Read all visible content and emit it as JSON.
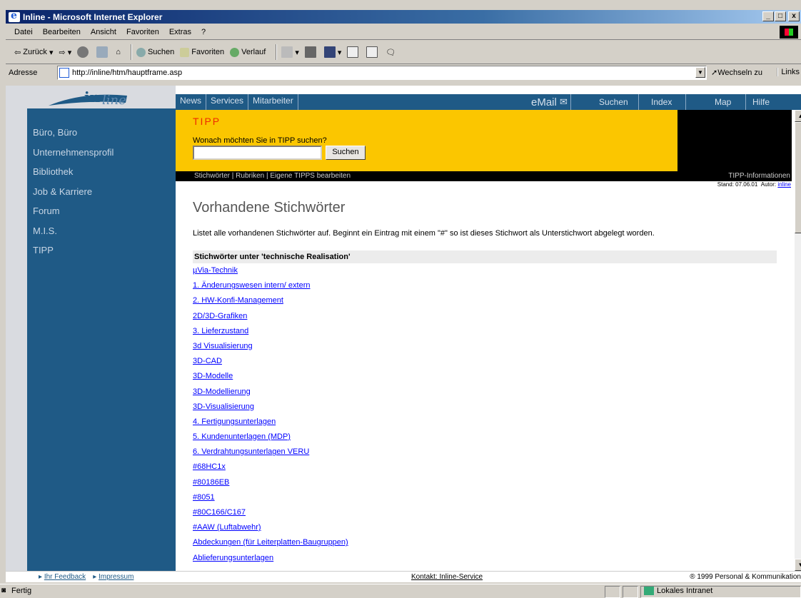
{
  "window": {
    "title": "Inline - Microsoft Internet Explorer",
    "min": "_",
    "max": "□",
    "close": "x"
  },
  "menu": [
    "Datei",
    "Bearbeiten",
    "Ansicht",
    "Favoriten",
    "Extras",
    "?"
  ],
  "toolbar": {
    "back": "Zurück",
    "search": "Suchen",
    "favorites": "Favoriten",
    "history": "Verlauf"
  },
  "address": {
    "label": "Adresse",
    "url": "http://inline/htm/hauptframe.asp",
    "go": "Wechseln zu",
    "links": "Links"
  },
  "logo": {
    "text": "inline"
  },
  "sidebar": {
    "items": [
      "Büro, Büro",
      "Unternehmensprofil",
      "Bibliothek",
      "Job & Karriere",
      "Forum",
      "M.I.S.",
      "TIPP"
    ]
  },
  "topnav": {
    "left": [
      "News",
      "Services",
      "Mitarbeiter"
    ],
    "email": "eMail",
    "right": [
      "Suchen",
      "Index",
      "Map",
      "Hilfe"
    ]
  },
  "tipp": {
    "label": "TIPP",
    "question": "Wonach möchten Sie in TIPP suchen?",
    "search_value": "",
    "button": "Suchen"
  },
  "tippbar": {
    "links": "Stichwörter | Rubriken | Eigene TIPPS bearbeiten",
    "info": "TIPP-Informationen"
  },
  "stand": {
    "date": "Stand: 07.06.01",
    "author_label": "Autor:",
    "author": "inline"
  },
  "content": {
    "heading": "Vorhandene Stichwörter",
    "intro": "Listet alle vorhandenen Stichwörter auf. Beginnt ein Eintrag mit einem \"#\" so ist dieses Stichwort als Unterstichwort abgelegt worden.",
    "section": "Stichwörter unter 'technische Realisation'",
    "links": [
      "µVia-Technik",
      "1. Änderungswesen intern/ extern",
      "2. HW-Konfi-Management",
      "2D/3D-Grafiken",
      "3. Lieferzustand",
      "3d Visualisierung",
      "3D-CAD",
      "3D-Modelle",
      "3D-Modellierung",
      "3D-Visualisierung",
      "4. Fertigungsunterlagen",
      "5. Kundenunterlagen (MDP)",
      "6. Verdrahtungsunterlagen VERU",
      "#68HC1x",
      "#80186EB",
      "#8051",
      "#80C166/C167",
      "#AAW (Luftabwehr)",
      "Abdeckungen (für Leiterplatten-Baugruppen)",
      "Ablieferungsunterlagen"
    ]
  },
  "footer": {
    "feedback": "Ihr Feedback",
    "impressum": "Impressum",
    "contact": "Kontakt: Inline-Service",
    "copyright": "® 1999 Personal & Kommunikation"
  },
  "status": {
    "text": "Fertig",
    "zone": "Lokales Intranet"
  }
}
